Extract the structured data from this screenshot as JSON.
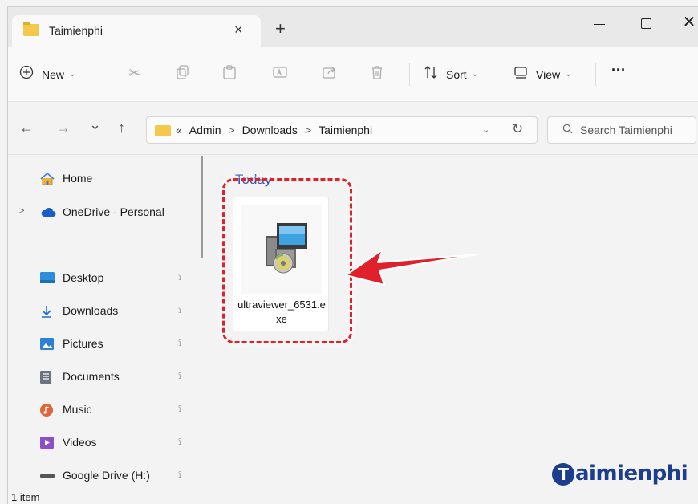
{
  "window": {
    "tab_title": "Taimienphi",
    "tab_close_glyph": "×",
    "tab_add_glyph": "+",
    "close_glyph": "✕"
  },
  "toolbar": {
    "new_label": "New",
    "sort_label": "Sort",
    "view_label": "View",
    "more_label": "···",
    "icons": [
      "plus-circle-icon",
      "cut-icon",
      "copy-icon",
      "paste-icon",
      "rename-icon",
      "share-icon",
      "delete-icon",
      "sort-icon",
      "view-icon"
    ]
  },
  "navigation": {
    "back_glyph": "←",
    "forward_glyph": "→",
    "recent_glyph": "⌄",
    "up_glyph": "↑"
  },
  "address": {
    "overflow": "«",
    "crumbs": [
      "Admin",
      "Downloads",
      "Taimienphi"
    ],
    "separator": ">",
    "dropdown_glyph": "⌄",
    "refresh_glyph": "↻"
  },
  "search": {
    "placeholder": "Search Taimienphi",
    "icon_glyph": "⚲"
  },
  "sidebar": {
    "expander_glyph": ">",
    "pin_glyph": "📌",
    "items": [
      {
        "label": "Home",
        "icon": "home-icon",
        "color": "#3b7fd4"
      },
      {
        "label": "OneDrive - Personal",
        "icon": "cloud-icon",
        "color": "#1a5fc7"
      },
      {
        "label": "Desktop",
        "icon": "desktop-icon",
        "color": "#2e8fd8"
      },
      {
        "label": "Downloads",
        "icon": "download-icon",
        "color": "#1f6fc9"
      },
      {
        "label": "Pictures",
        "icon": "pictures-icon",
        "color": "#2f7fd5"
      },
      {
        "label": "Documents",
        "icon": "documents-icon",
        "color": "#6b7280"
      },
      {
        "label": "Music",
        "icon": "music-icon",
        "color": "#e0653a"
      },
      {
        "label": "Videos",
        "icon": "videos-icon",
        "color": "#8b4fc9"
      },
      {
        "label": "Google Drive (H:)",
        "icon": "drive-icon",
        "color": "#555555"
      }
    ]
  },
  "content": {
    "group_header": "Today",
    "files": [
      {
        "name": "ultraviewer_6531.exe",
        "icon": "installer-icon"
      }
    ],
    "highlight_color": "#e0202a"
  },
  "status": {
    "item_count": "1 item"
  },
  "watermark": {
    "text": "aimienphi",
    "badge_letter": "T"
  }
}
